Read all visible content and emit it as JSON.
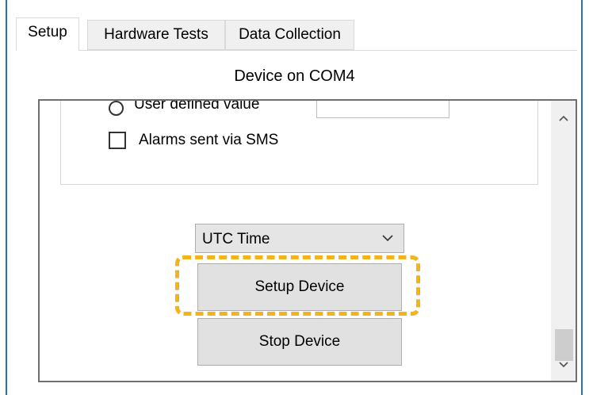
{
  "tabs": [
    {
      "label": "Setup",
      "active": true
    },
    {
      "label": "Hardware Tests",
      "active": false
    },
    {
      "label": "Data Collection",
      "active": false
    }
  ],
  "device_title": "Device on COM4",
  "panel": {
    "radio_label": "User defined value",
    "checkbox_label": "Alarms sent via SMS",
    "checkbox_checked": false,
    "time_select": {
      "value": "UTC Time"
    },
    "setup_button": "Setup Device",
    "stop_button": "Stop Device"
  },
  "colors": {
    "frame_border": "#2d6fc4",
    "highlight": "#f2b31c"
  },
  "icons": {
    "select_arrow": "chevron-down-icon",
    "scroll_up": "chevron-up-icon",
    "scroll_down": "chevron-down-icon"
  }
}
